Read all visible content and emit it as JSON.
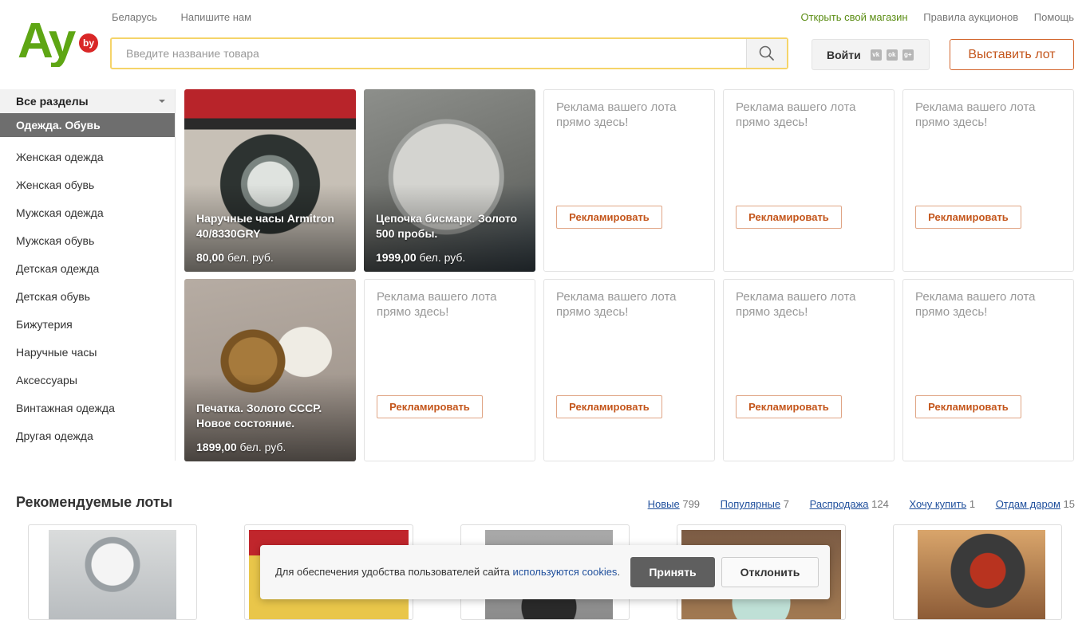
{
  "header": {
    "logo_text": "Ау",
    "logo_badge": "by",
    "top_left_links": [
      "Беларусь",
      "Напишите нам"
    ],
    "open_shop": "Открыть свой магазин",
    "top_right_links": [
      "Правила аукционов",
      "Помощь"
    ],
    "search_placeholder": "Введите название товара",
    "login_label": "Войти",
    "social_icons": [
      "vk-icon",
      "odnoklassniki-icon",
      "google-plus-icon"
    ],
    "sell_button": "Выставить лот",
    "accent_color": "#5ea614"
  },
  "sidebar": {
    "all_sections": "Все разделы",
    "current_section": "Одежда. Обувь",
    "items": [
      "Женская одежда",
      "Женская обувь",
      "Мужская одежда",
      "Мужская обувь",
      "Детская одежда",
      "Детская обувь",
      "Бижутерия",
      "Наручные часы",
      "Аксессуары",
      "Винтажная одежда",
      "Другая одежда"
    ]
  },
  "lots": [
    {
      "title": "Наручные часы Armitron 40/8330GRY",
      "price": "80,00",
      "currency": "бел. руб."
    },
    {
      "title": "Цепочка бисмарк. Золото 500 пробы.",
      "price": "1999,00",
      "currency": "бел. руб."
    },
    {
      "title": "Печатка. Золото СССР. Новое состояние.",
      "price": "1899,00",
      "currency": "бел. руб."
    }
  ],
  "ad_slot": {
    "text": "Реклама вашего лота прямо здесь!",
    "button": "Рекламировать"
  },
  "recommended": {
    "title": "Рекомендуемые лоты",
    "tabs": [
      {
        "label": "Новые",
        "count": "799"
      },
      {
        "label": "Популярные",
        "count": "7"
      },
      {
        "label": "Распродажа",
        "count": "124"
      },
      {
        "label": "Хочу купить",
        "count": "1"
      },
      {
        "label": "Отдам даром",
        "count": "15"
      }
    ]
  },
  "cookie": {
    "text": "Для обеспечения удобства пользователей сайта",
    "link": "используются cookies",
    "text_end": ".",
    "accept": "Принять",
    "decline": "Отклонить"
  }
}
